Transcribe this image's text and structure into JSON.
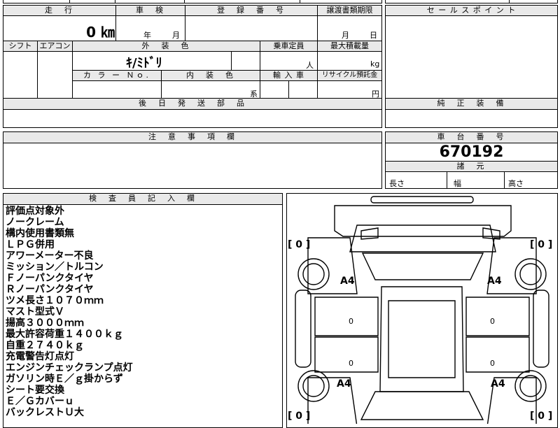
{
  "top_grid": {
    "mileage": {
      "header": "走　行",
      "value": "0 ㎞"
    },
    "inspection": {
      "header": "車　検",
      "year_unit": "年",
      "month_unit": "月"
    },
    "registration": {
      "header": "登　録　番　号"
    },
    "transfer_deadline": {
      "header": "譲渡書類期限",
      "month_unit": "月",
      "day_unit": "日"
    },
    "shift": {
      "header": "シフト"
    },
    "aircon": {
      "header": "エアコン"
    },
    "exterior_color": {
      "header": "外　装　色",
      "value": "ｷ/ﾐﾄﾞﾘ"
    },
    "capacity": {
      "header": "乗車定員",
      "unit": "人"
    },
    "max_load": {
      "header": "最大積載量",
      "unit": "kg"
    },
    "color_no": {
      "header": "カ ラ ー Ｎｏ."
    },
    "interior_color": {
      "header": "内　装　色",
      "unit": "系"
    },
    "import": {
      "header": "輸 入 車"
    },
    "recycle": {
      "header": "リサイクル預託金",
      "unit": "円"
    },
    "later_parts": {
      "header": "後　日　発　送　部　品"
    }
  },
  "sales_point": {
    "header": "セ ー ル ス ポ イ ン ト"
  },
  "genuine_equipment": {
    "header": "純　正　装　備"
  },
  "caution": {
    "header": "注　意　事　項　欄"
  },
  "chassis": {
    "header": "車　台　番　号",
    "value": "670192"
  },
  "dimensions": {
    "header": "諸　元",
    "length": "長さ",
    "width": "幅",
    "height": "高さ"
  },
  "inspector": {
    "header": "検　査　員　記　入　欄",
    "lines": [
      "評価点対象外",
      "ノークレーム",
      "構内使用書類無",
      "ＬＰＧ併用",
      "アワーメーター不良",
      "ミッション／トルコン",
      "Ｆノーパンクタイヤ",
      "Ｒノーパンクタイヤ",
      "ツメ長さ１０７０ｍｍ",
      "マスト型式Ｖ",
      "揚高３０００ｍｍ",
      "最大許容荷重１４００ｋｇ",
      "自重２７４０ｋｇ",
      "充電警告灯点灯",
      "エンジンチェックランプ点灯",
      "ガソリン時Ｅ／ｇ掛からず",
      "シート要交換",
      "Ｅ／Ｇカバーｕ",
      "バックレストＵ大"
    ]
  },
  "diagram": {
    "bracket_tl": "[ 0 ]",
    "bracket_tr": "[ 0 ]",
    "bracket_bl": "[ 0 ]",
    "bracket_br": "[ 0 ]",
    "mark_fl": "A4",
    "mark_fr": "A4",
    "mark_rl": "A4",
    "mark_rr": "A4",
    "door_fl": "0",
    "door_fr": "0",
    "door_rl": "0",
    "door_rr": "0"
  }
}
